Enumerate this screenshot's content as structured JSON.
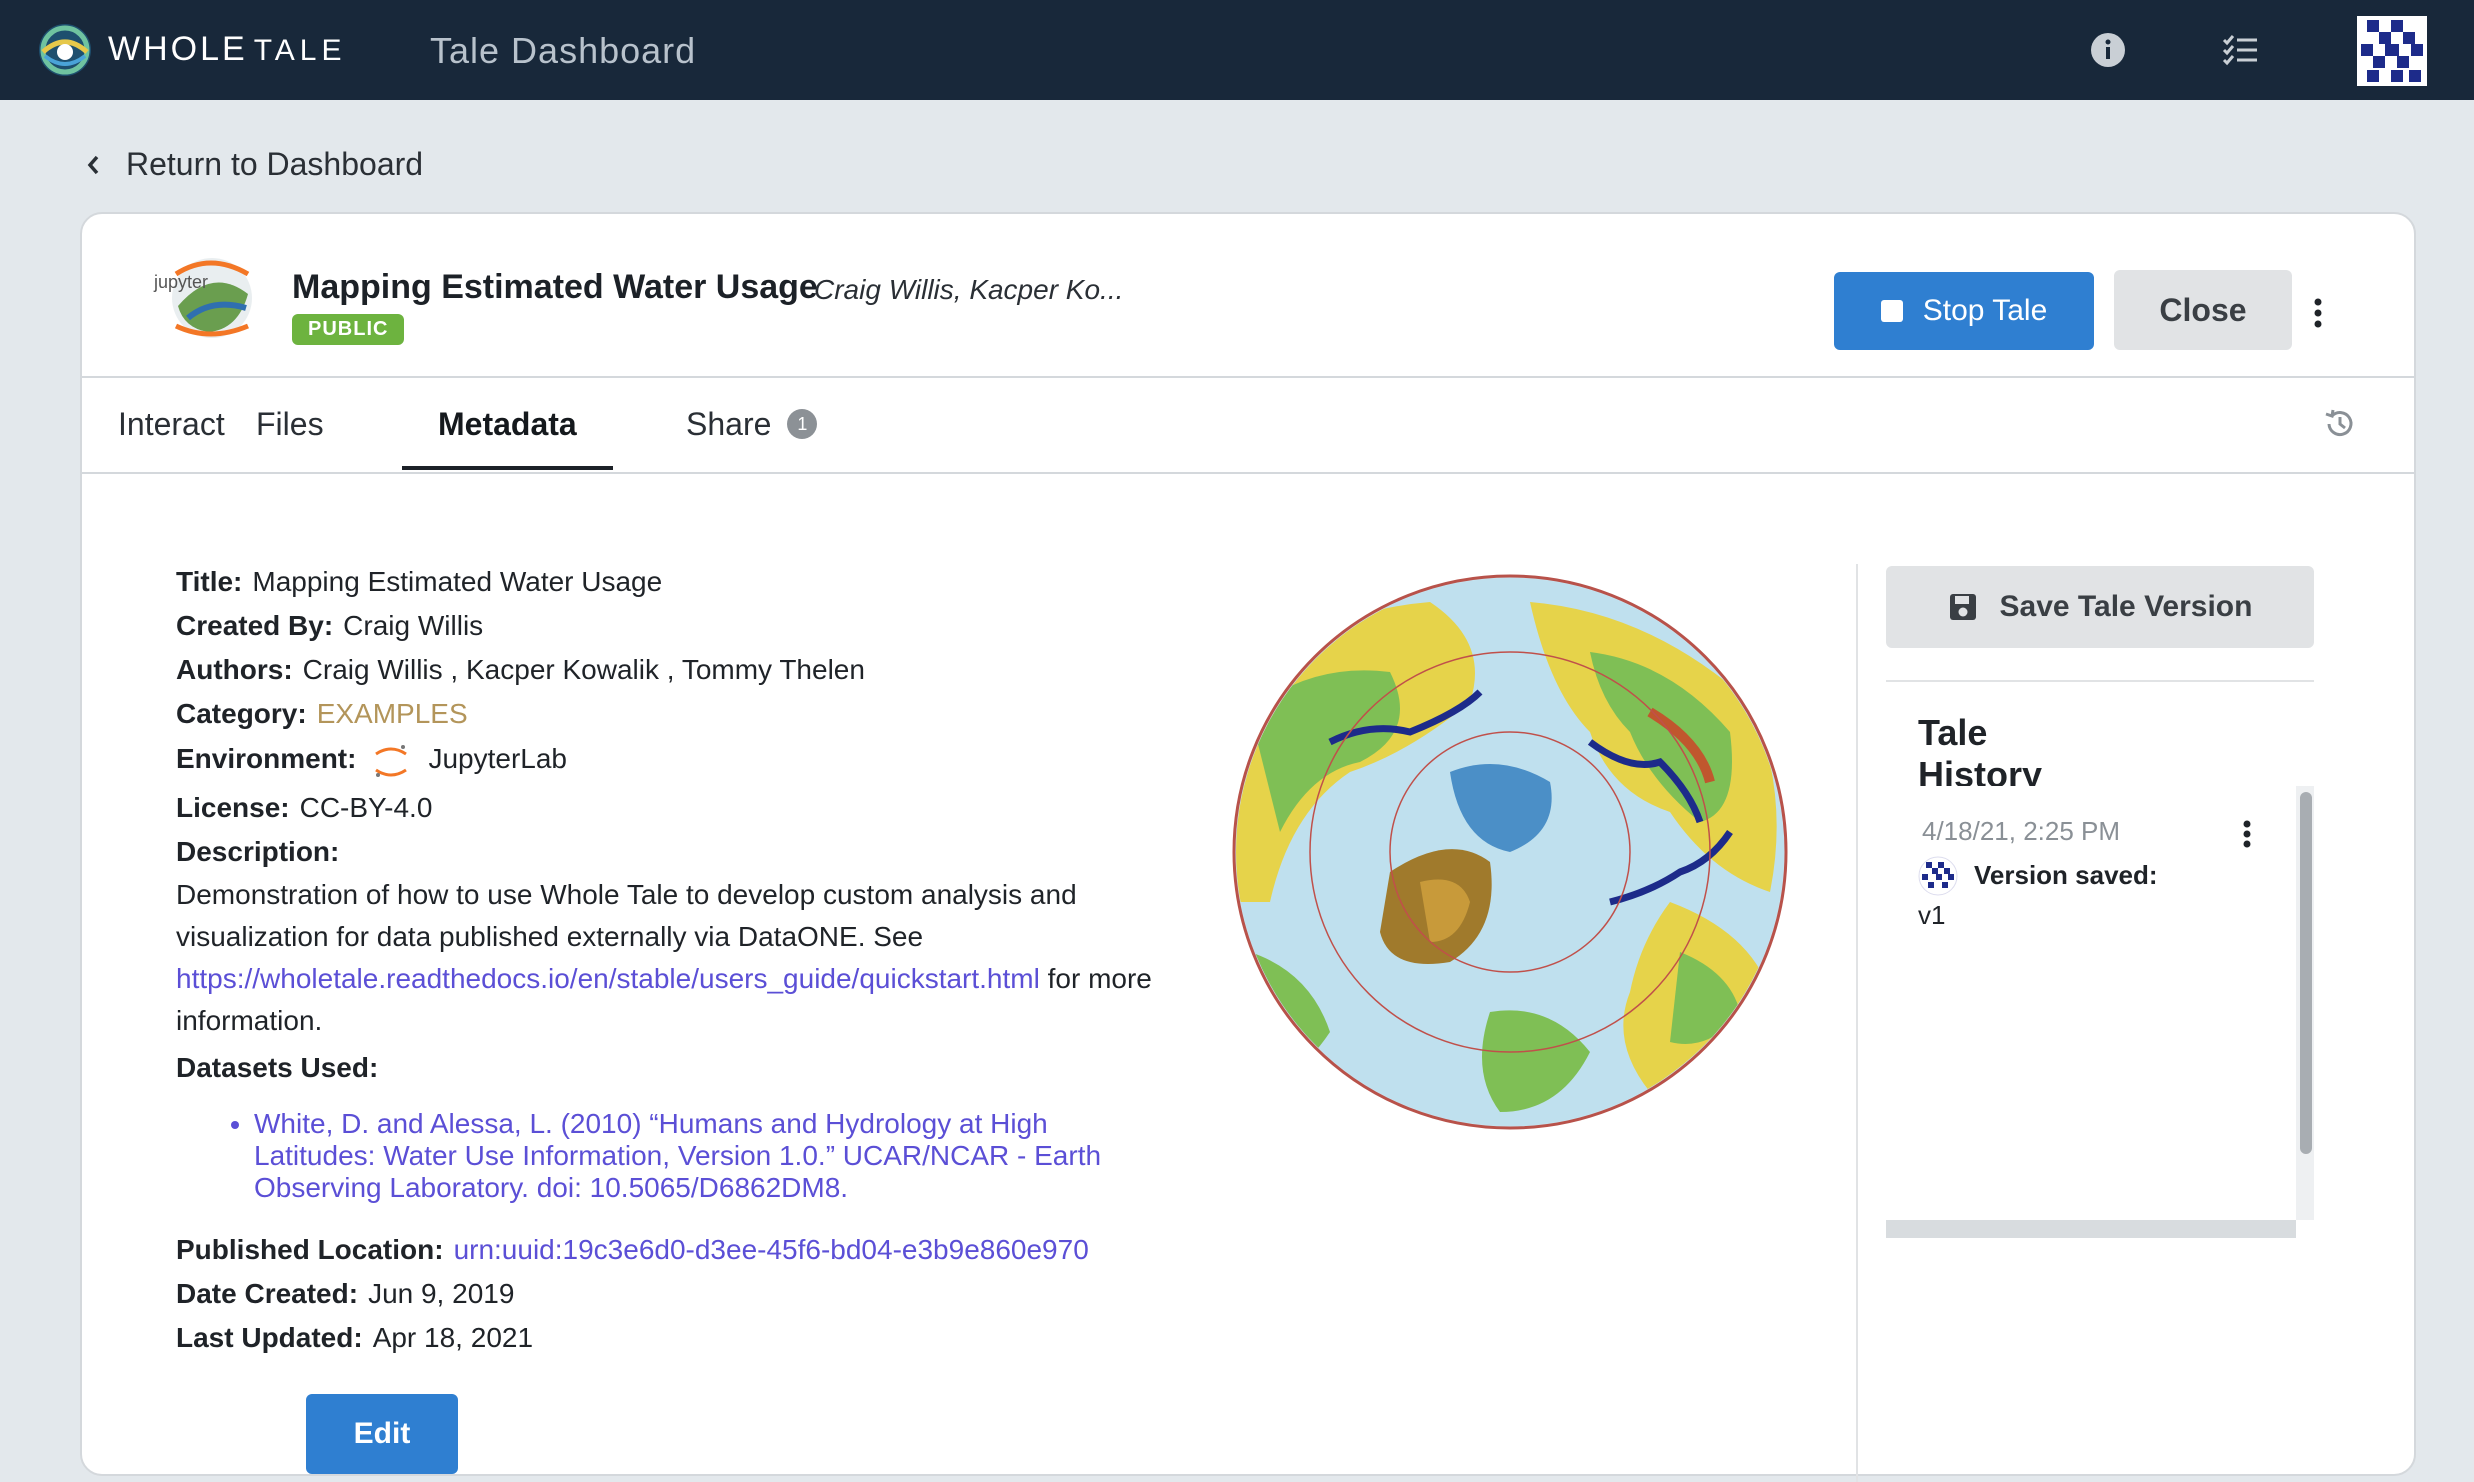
{
  "topbar": {
    "brand_primary": "WHOLE",
    "brand_secondary": "TALE",
    "title": "Tale Dashboard",
    "icons": [
      "info-icon",
      "checklist-icon",
      "user-avatar"
    ]
  },
  "nav": {
    "return_label": "Return to Dashboard"
  },
  "tale": {
    "title": "Mapping Estimated Water Usage",
    "authors_short": "Craig Willis, Kacper Ko...",
    "visibility": "PUBLIC",
    "logo_text": "jupyter"
  },
  "actions": {
    "stop_label": "Stop Tale",
    "close_label": "Close"
  },
  "tabs": [
    {
      "label": "Interact",
      "active": false
    },
    {
      "label": "Files",
      "active": false
    },
    {
      "label": "Metadata",
      "active": true
    },
    {
      "label": "Share",
      "active": false,
      "count": "1"
    }
  ],
  "metadata": {
    "title_label": "Title:",
    "title_value": "Mapping Estimated Water Usage",
    "created_by_label": "Created By:",
    "created_by_value": "Craig Willis",
    "authors_label": "Authors:",
    "authors": [
      "Craig Willis",
      "Kacper Kowalik",
      "Tommy Thelen"
    ],
    "category_label": "Category:",
    "category_value": "EXAMPLES",
    "environment_label": "Environment:",
    "environment_value": "JupyterLab",
    "license_label": "License:",
    "license_value": "CC-BY-4.0",
    "description_label": "Description:",
    "description_text": "Demonstration of how to use Whole Tale to develop custom analysis and visualization for data published externally via DataONE. See",
    "description_link": "https://wholetale.readthedocs.io/en/stable/users_guide/quickstart.html",
    "description_suffix": "for more information.",
    "datasets_label": "Datasets Used:",
    "datasets": [
      "White, D. and Alessa, L. (2010) “Humans and Hydrology at High Latitudes: Water Use Information, Version 1.0.” UCAR/NCAR - Earth Observing Laboratory. doi: 10.5065/D6862DM8."
    ],
    "published_label": "Published Location:",
    "published_value": "urn:uuid:19c3e6d0-d3ee-45f6-bd04-e3b9e860e970",
    "date_created_label": "Date Created:",
    "date_created_value": "Jun 9, 2019",
    "last_updated_label": "Last Updated:",
    "last_updated_value": "Apr 18, 2021",
    "edit_label": "Edit"
  },
  "history": {
    "save_label": "Save Tale Version",
    "title": "Tale History",
    "entries": [
      {
        "date": "4/18/21, 2:25 PM",
        "action": "Version saved:",
        "version": "v1"
      }
    ]
  },
  "colors": {
    "topbar": "#18283a",
    "primary_button": "#2f7fd1",
    "public_badge": "#6db33f",
    "link": "#5b4fd6",
    "category": "#b3955a"
  }
}
